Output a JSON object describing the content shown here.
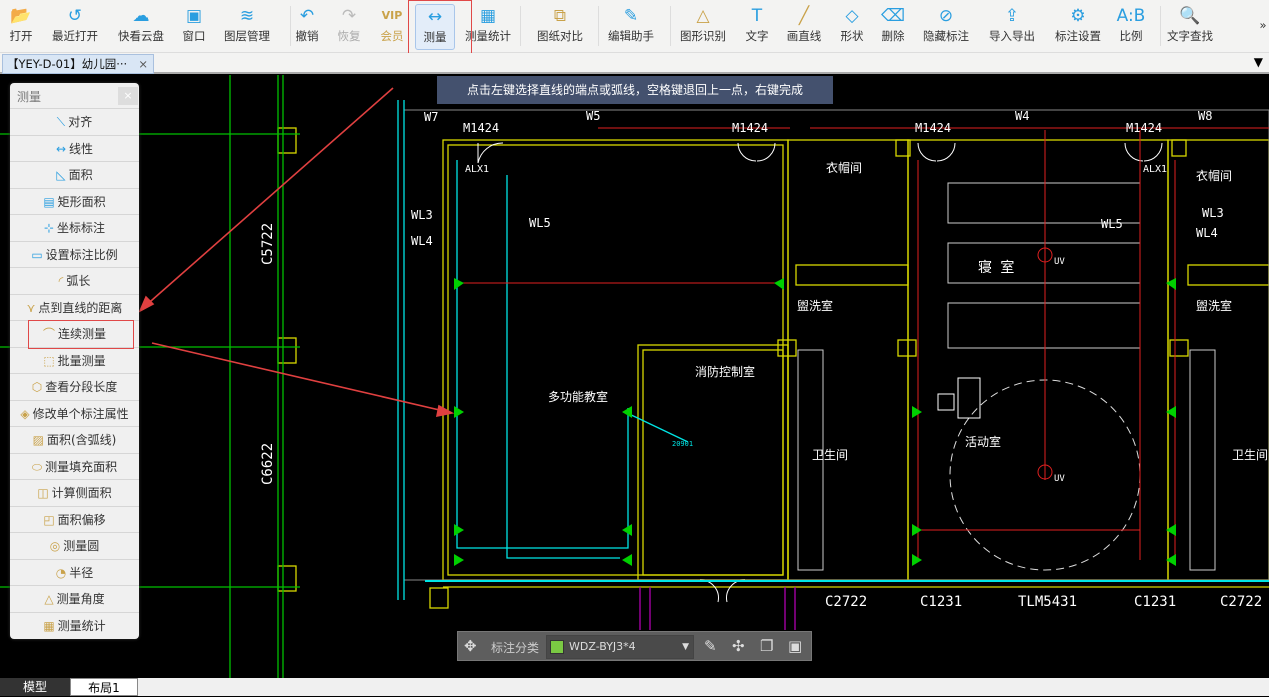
{
  "toolbar": {
    "items": [
      {
        "label": "打开",
        "icon": "folder-open-icon"
      },
      {
        "label": "最近打开",
        "icon": "clock-icon"
      },
      {
        "label": "快看云盘",
        "icon": "cloud-icon"
      },
      {
        "label": "窗口",
        "icon": "window-icon"
      },
      {
        "label": "图层管理",
        "icon": "layers-icon"
      },
      {
        "label": "撤销",
        "icon": "undo-icon"
      },
      {
        "label": "恢复",
        "icon": "redo-icon"
      },
      {
        "label": "会员",
        "icon": "vip-icon"
      },
      {
        "label": "测量",
        "icon": "ruler-icon"
      },
      {
        "label": "测量统计",
        "icon": "measure-stats-icon"
      },
      {
        "label": "图纸对比",
        "icon": "compare-icon"
      },
      {
        "label": "编辑助手",
        "icon": "cad-edit-icon"
      },
      {
        "label": "图形识别",
        "icon": "shape-recognize-icon"
      },
      {
        "label": "文字",
        "icon": "text-icon"
      },
      {
        "label": "画直线",
        "icon": "line-icon"
      },
      {
        "label": "形状",
        "icon": "shape-icon"
      },
      {
        "label": "删除",
        "icon": "eraser-icon"
      },
      {
        "label": "隐藏标注",
        "icon": "eye-hidden-icon"
      },
      {
        "label": "导入导出",
        "icon": "import-export-icon"
      },
      {
        "label": "标注设置",
        "icon": "annotation-settings-icon"
      },
      {
        "label": "比例",
        "icon": "scale-icon"
      },
      {
        "label": "文字查找",
        "icon": "text-search-icon"
      }
    ],
    "more": "»",
    "active": "测量"
  },
  "tabs": {
    "doc_title": "【YEY-D-01】幼儿园···",
    "close": "×"
  },
  "hint": "点击左键选择直线的端点或弧线，空格键退回上一点，右键完成",
  "panel": {
    "title": "测量",
    "close": "×",
    "items": [
      "对齐",
      "线性",
      "面积",
      "矩形面积",
      "坐标标注",
      "设置标注比例",
      "弧长",
      "点到直线的距离",
      "连续测量",
      "批量测量",
      "查看分段长度",
      "修改单个标注属性",
      "面积(含弧线)",
      "测量填充面积",
      "计算侧面积",
      "面积偏移",
      "测量圆",
      "半径",
      "测量角度",
      "测量统计"
    ],
    "highlighted": "连续测量"
  },
  "annotation_bar": {
    "label": "标注分类",
    "selected": "WDZ-BYJ3*4",
    "swatch": "#7ac943"
  },
  "layout_tabs": [
    "模型",
    "布局1"
  ],
  "drawing_labels": {
    "w7": "W7",
    "w5": "W5",
    "w4": "W4",
    "w8": "W8",
    "m1": "M1424",
    "m2": "M1424",
    "m3": "M1424",
    "m4": "M1424",
    "alx1": "ALX1",
    "alx2": "ALX1",
    "ym1": "衣帽间",
    "ym2": "衣帽间",
    "wl3a": "WL3",
    "wl4a": "WL4",
    "wl5a": "WL5",
    "wl5b": "WL5",
    "wl3b": "WL3",
    "wl4b": "WL4",
    "qs": "寝 室",
    "gx1": "盥洗室",
    "gx2": "盥洗室",
    "xf": "消防控制室",
    "dgn": "多功能教室",
    "ws1": "卫生间",
    "ws2": "卫生间",
    "hd": "活动室",
    "c5722": "C5722",
    "c6622": "C6622",
    "c2722a": "C2722",
    "c2722b": "C2722",
    "c1231a": "C1231",
    "c1231b": "C1231",
    "tlm": "TLM5431",
    "uv1": "UV",
    "uv2": "UV",
    "dim": "20901"
  },
  "colors": {
    "accent": "#2a9ee0",
    "highlight_box": "#e04848",
    "wall": "#d8d800",
    "cyan": "#00e5e5",
    "green": "#00d000",
    "red": "#e02020"
  }
}
